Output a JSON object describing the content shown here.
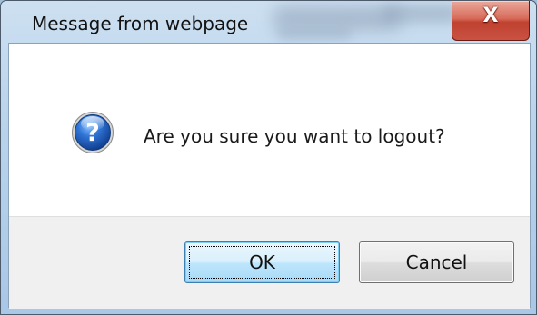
{
  "dialog": {
    "title": "Message from webpage",
    "close_glyph": "X",
    "message": "Are you sure you want to logout?",
    "icon": "question-icon",
    "buttons": {
      "ok_label": "OK",
      "cancel_label": "Cancel"
    },
    "colors": {
      "close_button": "#c7402f",
      "icon_blue": "#1f5fb4",
      "ok_border": "#3c7fb1",
      "footer_bg": "#f0f0f0"
    }
  }
}
